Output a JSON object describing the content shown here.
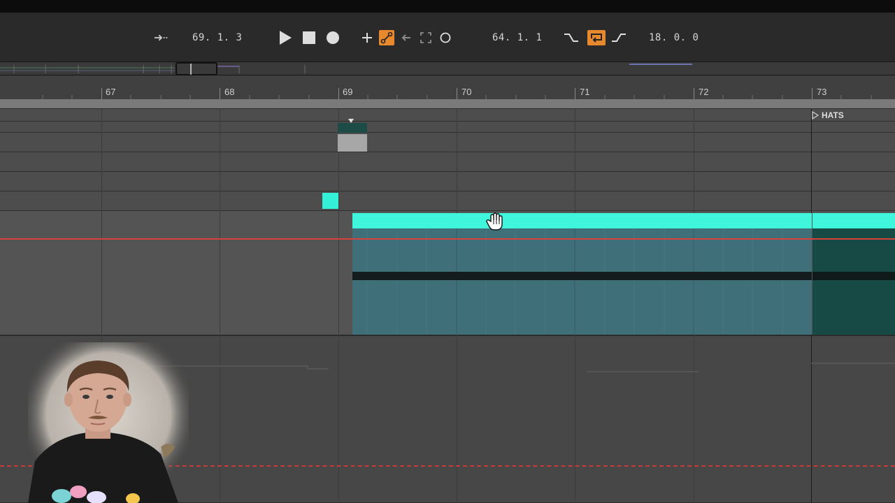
{
  "transport": {
    "follow_icon": "arrow-follow-icon",
    "song_position": "69.  1.  3",
    "loop_start": "64.  1.  1",
    "loop_length": "18.  0.  0",
    "accent_color": "#e8892e"
  },
  "ruler": {
    "bars": [
      "67",
      "68",
      "69",
      "70",
      "71",
      "72",
      "73"
    ]
  },
  "locator": {
    "label": "HATS"
  },
  "colors": {
    "clip_cyan": "#33f0d6",
    "clip_teal": "#3e6e78",
    "clip_dark_teal": "#174a44",
    "automation_red": "#d9413e"
  }
}
